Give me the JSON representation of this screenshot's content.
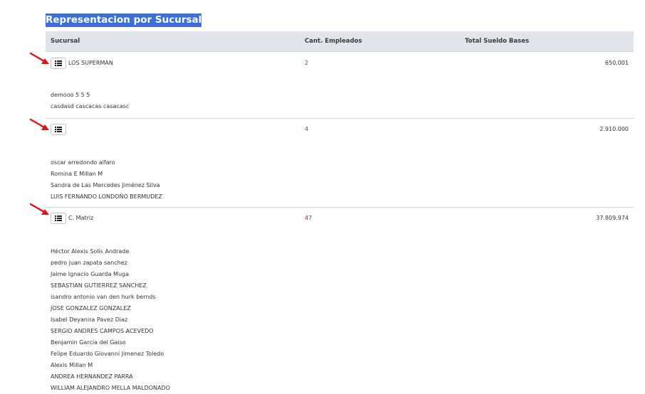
{
  "title": "Representacion por Sucursal",
  "columns": {
    "sucursal": "Sucursal",
    "empleados": "Cant. Empleados",
    "sueldos": "Total Sueldo Bases"
  },
  "branches": [
    {
      "name": "LOS SUPERMAN",
      "count": "2",
      "total": "650.001",
      "employees": [
        "demooo 5 5 5",
        "casdasd cascacas casacasc"
      ]
    },
    {
      "name": "",
      "count": "4",
      "total": "2.910.000",
      "employees": [
        "oscar arredondo alfaro",
        "Romina E Millan M",
        "Sandra de Las Mercedes Jiménez Silva",
        "LUIS FERNANDO LONDOÑO BERMUDEZ"
      ]
    },
    {
      "name": "C. Matriz",
      "count": "47",
      "total": "37.809.974",
      "employees": [
        "Héctor Alexis Solís Andrade",
        "pedro juan zapata sanchez",
        "Jaime Ignacio Guarda Muga",
        "SEBASTIAN GUTIERREZ SANCHEZ",
        "isandro antonio van den hurk bernds",
        "JOSE GONZALEZ GONZALEZ",
        "Isabel Deyanira Pavez Diaz",
        "SERGIO ANDRÉS CAMPOS ACEVEDO",
        "Benjamin Garcia del Gaiso",
        "Felipe Eduardo Giovanni Jimenez Toledo",
        "Alexis Millan M",
        "ANDREA HERNANDEZ PARRA",
        "WILLIAM ALEJANDRO MELLA MALDONADO"
      ]
    }
  ],
  "colors": {
    "title_bg": "#3a6fd8",
    "header_bg": "#e1e4ea",
    "count_text": "#7a3535",
    "arrow": "#e3101a"
  }
}
